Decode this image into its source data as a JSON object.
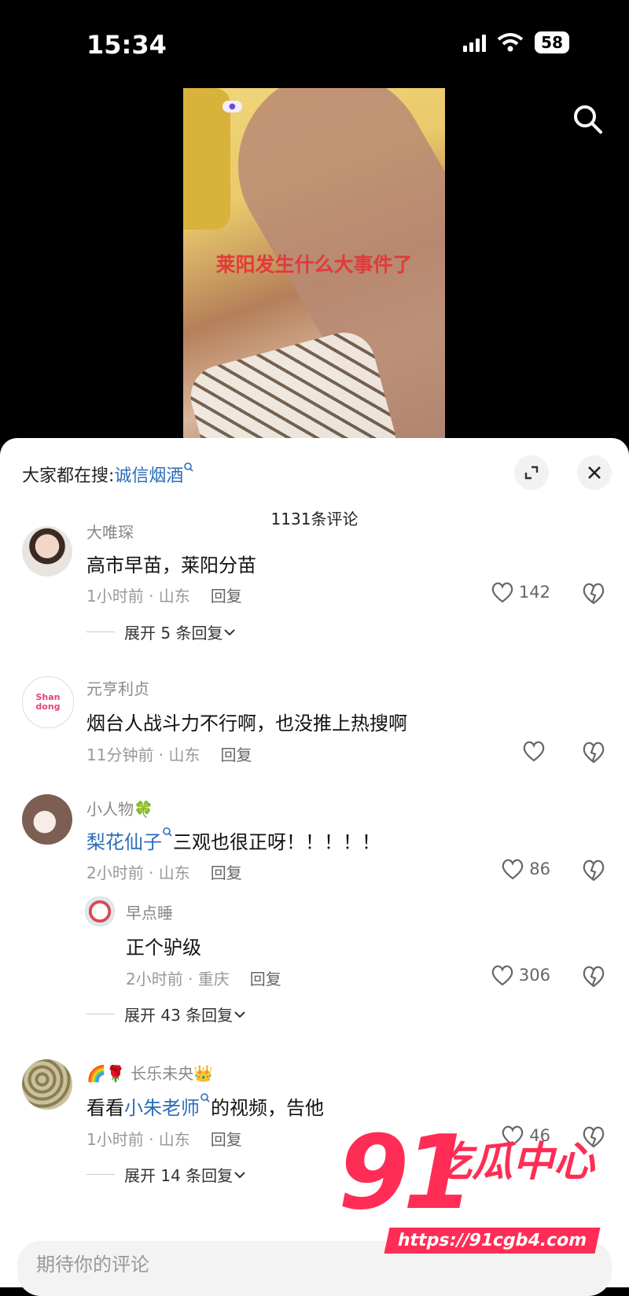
{
  "status_bar": {
    "time": "15:34",
    "battery": "58"
  },
  "video": {
    "caption": "莱阳发生什么大事件了"
  },
  "sheet": {
    "search_prefix": "大家都在搜:",
    "search_keyword": "诚信烟酒",
    "comment_count": "1131条评论"
  },
  "comments": [
    {
      "name": "大唯琛",
      "text": "高市早苗，莱阳分苗",
      "meta": "1小时前 · 山东",
      "reply": "回复",
      "likes": "142",
      "expand": "展开 5 条回复"
    },
    {
      "name": "元亨利贞",
      "avatar_text": "Shan dong",
      "text": "烟台人战斗力不行啊，也没推上热搜啊",
      "meta": "11分钟前 · 山东",
      "reply": "回复",
      "likes": ""
    },
    {
      "name": "小人物🍀",
      "text_link": "梨花仙子",
      "text_rest": "三观也很正呀！！！！！",
      "meta": "2小时前 · 山东",
      "reply": "回复",
      "likes": "86",
      "sub": {
        "name": "早点睡",
        "text": "正个驴级",
        "meta": "2小时前 · 重庆",
        "reply": "回复",
        "likes": "306"
      },
      "expand": "展开 43 条回复"
    },
    {
      "name": "🌈🌹 长乐未央👑",
      "text_prefix": "看看",
      "text_link": "小朱老师",
      "text_rest": "的视频，告他",
      "meta": "1小时前 · 山东",
      "reply": "回复",
      "likes": "46",
      "expand": "展开 14 条回复"
    }
  ],
  "input_placeholder": "期待你的评论",
  "watermark": {
    "number": "91",
    "text": "吃瓜中心",
    "url": "https://91cgb4.com"
  }
}
